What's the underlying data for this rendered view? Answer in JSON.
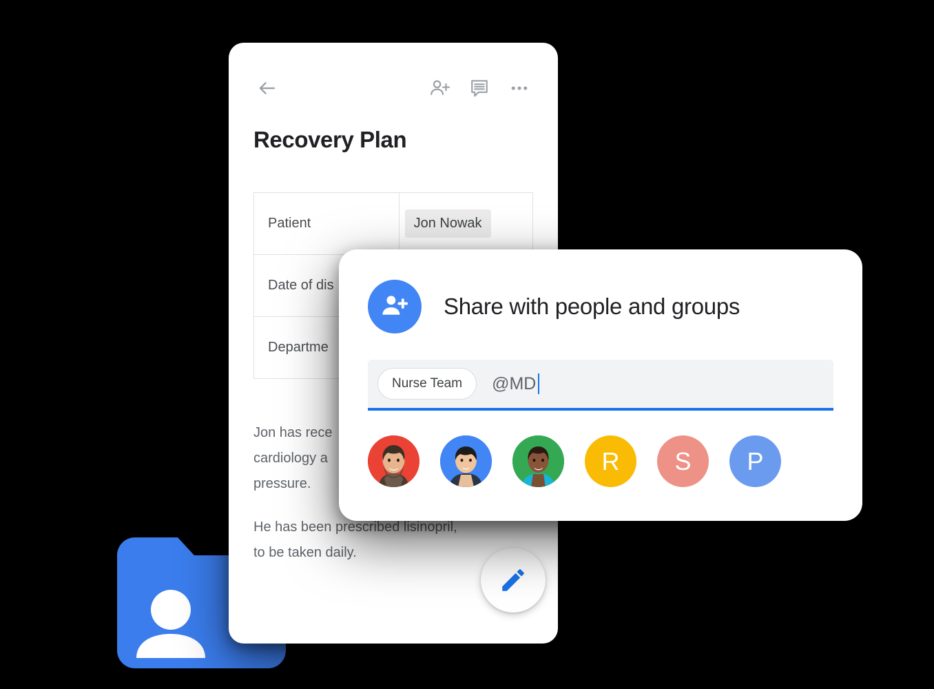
{
  "document_card": {
    "toolbar": {
      "back_label": "Back",
      "back_icon": "arrow-left-icon",
      "add_people_icon": "person-add-icon",
      "comment_icon": "comment-icon",
      "more_icon": "more-horizontal-icon"
    },
    "title": "Recovery Plan",
    "table": {
      "rows": [
        {
          "label": "Patient",
          "value": "Jon Nowak",
          "value_is_chip": true
        },
        {
          "label": "Date of dis",
          "value": "",
          "value_is_chip": false
        },
        {
          "label": "Departme",
          "value": "",
          "value_is_chip": false
        }
      ]
    },
    "body_paragraphs": [
      "Jon has rece\ncardiology a\npressure.",
      "He has been prescribed lisinopril,\nto be taken daily."
    ],
    "fab": {
      "label": "Edit",
      "icon": "pencil-edit-icon",
      "color": "#1a73e8"
    }
  },
  "share_dialog": {
    "icon": "person-add-icon",
    "icon_bg": "#4285F4",
    "title": "Share with people and groups",
    "input": {
      "chips": [
        "Nurse Team"
      ],
      "typed_text": "@MD",
      "caret_visible": true,
      "background": "#f1f3f4",
      "underline_color": "#1a73e8"
    },
    "suggestions": [
      {
        "type": "photo",
        "name": "avatar-photo-1",
        "bg": "#EA4335",
        "letter": ""
      },
      {
        "type": "photo",
        "name": "avatar-photo-2",
        "bg": "#4285F4",
        "letter": ""
      },
      {
        "type": "photo",
        "name": "avatar-photo-3",
        "bg": "#34A853",
        "letter": ""
      },
      {
        "type": "letter",
        "name": "avatar-letter-r",
        "bg": "#FABB05",
        "letter": "R"
      },
      {
        "type": "letter",
        "name": "avatar-letter-s",
        "bg": "#EE9186",
        "letter": "S"
      },
      {
        "type": "letter",
        "name": "avatar-letter-p",
        "bg": "#6B9BEE",
        "letter": "P"
      }
    ]
  },
  "drive_folder": {
    "label": "Shared folder",
    "icon": "shared-folder-icon",
    "color": "#3B7DED"
  },
  "theme": {
    "background": "#000000",
    "card_background": "#ffffff",
    "accent_blue": "#1a73e8",
    "text_primary": "#202124",
    "text_secondary": "#5f6368",
    "icon_gray": "#9aa0a6"
  }
}
